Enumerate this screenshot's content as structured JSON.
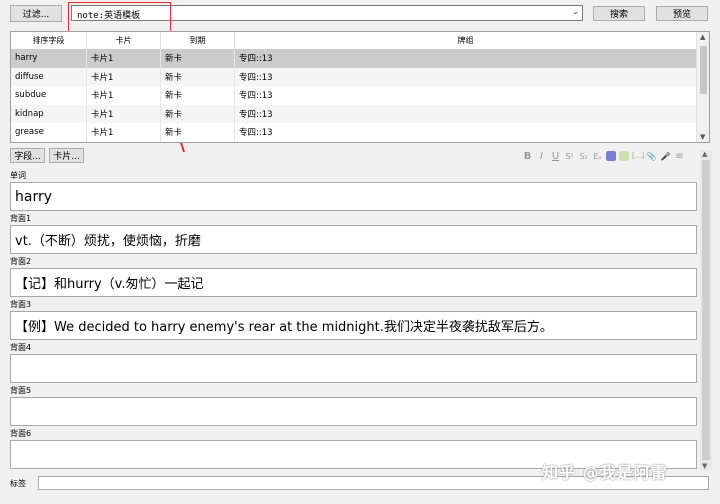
{
  "toolbar": {
    "filter_label": "过滤...",
    "search_value": "note:英语模板",
    "search_label": "搜索",
    "preview_label": "预览"
  },
  "table": {
    "columns": [
      "排序字段",
      "卡片",
      "到期",
      "牌组"
    ],
    "rows": [
      {
        "sort_field": "harry",
        "card": "卡片1",
        "due": "新卡",
        "deck": "专四::13"
      },
      {
        "sort_field": "diffuse",
        "card": "卡片1",
        "due": "新卡",
        "deck": "专四::13"
      },
      {
        "sort_field": "subdue",
        "card": "卡片1",
        "due": "新卡",
        "deck": "专四::13"
      },
      {
        "sort_field": "kidnap",
        "card": "卡片1",
        "due": "新卡",
        "deck": "专四::13"
      },
      {
        "sort_field": "grease",
        "card": "卡片1",
        "due": "新卡",
        "deck": "专四::13"
      }
    ]
  },
  "editor": {
    "fields_button": "字段...",
    "cards_button": "卡片...",
    "format_icons": [
      "bold-icon",
      "italic-icon",
      "underline-icon",
      "superscript-icon",
      "subscript-icon",
      "clear-format-icon",
      "text-color-icon",
      "highlight-icon",
      "cloze-icon",
      "attach-icon",
      "record-icon",
      "more-icon"
    ],
    "format_glyphs": {
      "bold": "B",
      "italic": "I",
      "underline": "U",
      "superscript": "S²",
      "subscript": "S₂",
      "clear": "Eₓ",
      "cloze": "[...]",
      "attach": "📎",
      "record": "🎤",
      "more": "≡"
    },
    "fields": [
      {
        "label": "单词",
        "value": "harry"
      },
      {
        "label": "背面1",
        "value": "vt.（不断）烦扰，使烦恼，折磨"
      },
      {
        "label": "背面2",
        "value": "【记】和hurry（v.匆忙）一起记"
      },
      {
        "label": "背面3",
        "value": "【例】We decided to harry enemy's rear at the midnight.我们决定半夜袭扰敌军后方。"
      },
      {
        "label": "背面4",
        "value": ""
      },
      {
        "label": "背面5",
        "value": ""
      },
      {
        "label": "背面6",
        "value": ""
      }
    ],
    "tags_label": "标签",
    "tags_value": ""
  },
  "watermark": "知乎 @我是阿雷",
  "colors": {
    "annotation_red": "#e03030",
    "selected_row": "#cbcbcb"
  }
}
